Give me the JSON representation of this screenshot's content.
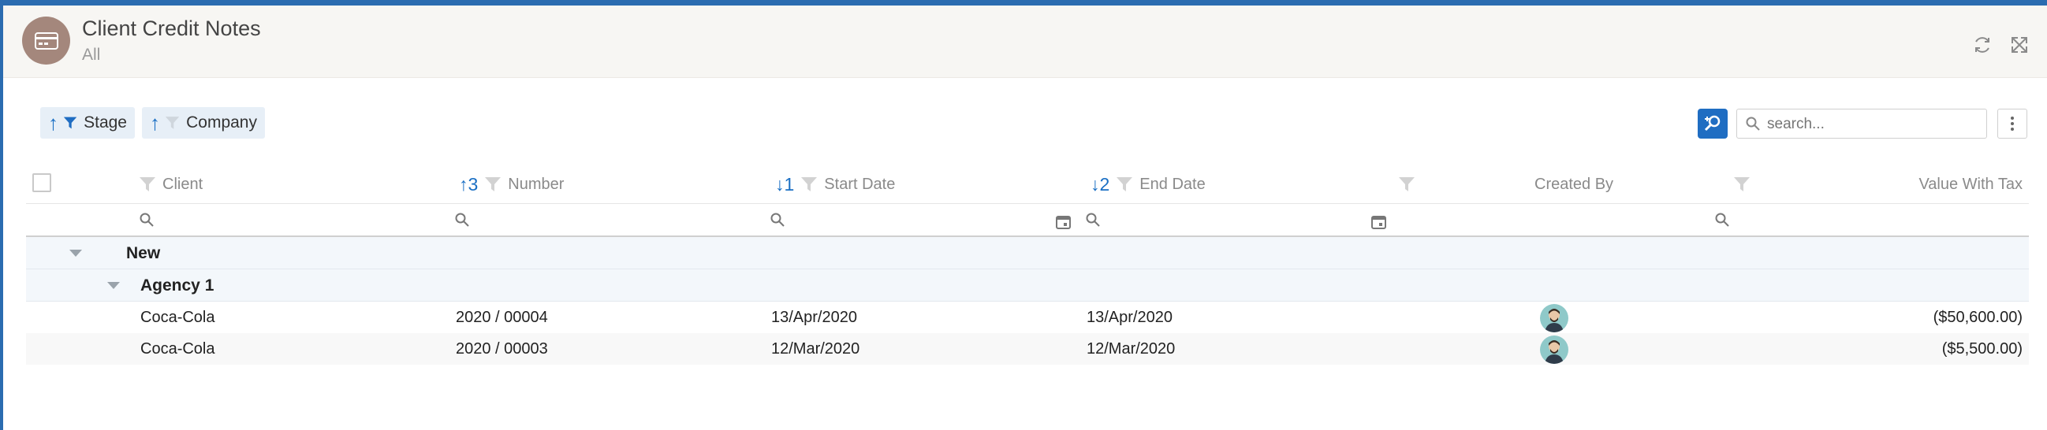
{
  "header": {
    "title": "Client Credit Notes",
    "subtitle": "All",
    "app_icon": "credit-card-icon"
  },
  "group_chips": [
    {
      "label": "Stage",
      "sort": "ascending",
      "filter_active": true
    },
    {
      "label": "Company",
      "sort": "ascending",
      "filter_active": false
    }
  ],
  "search": {
    "placeholder": "search..."
  },
  "columns": {
    "client": {
      "label": "Client"
    },
    "number": {
      "label": "Number",
      "sort_index": "3",
      "sort": "ascending"
    },
    "start_date": {
      "label": "Start Date",
      "sort_index": "1",
      "sort": "descending"
    },
    "end_date": {
      "label": "End Date",
      "sort_index": "2",
      "sort": "descending"
    },
    "created_by": {
      "label": "Created By"
    },
    "value_with_tax": {
      "label": "Value With Tax"
    }
  },
  "groups": {
    "stage": {
      "label": "New"
    },
    "company": {
      "label": "Agency 1"
    }
  },
  "rows": [
    {
      "client": "Coca-Cola",
      "number": "2020 / 00004",
      "start_date": "13/Apr/2020",
      "end_date": "13/Apr/2020",
      "value": "($50,600.00)"
    },
    {
      "client": "Coca-Cola",
      "number": "2020 / 00003",
      "start_date": "12/Mar/2020",
      "end_date": "12/Mar/2020",
      "value": "($5,500.00)"
    }
  ],
  "colors": {
    "accent": "#1f6dc2",
    "app_icon_bg": "#a4877c",
    "header_bg": "#f7f6f3"
  }
}
